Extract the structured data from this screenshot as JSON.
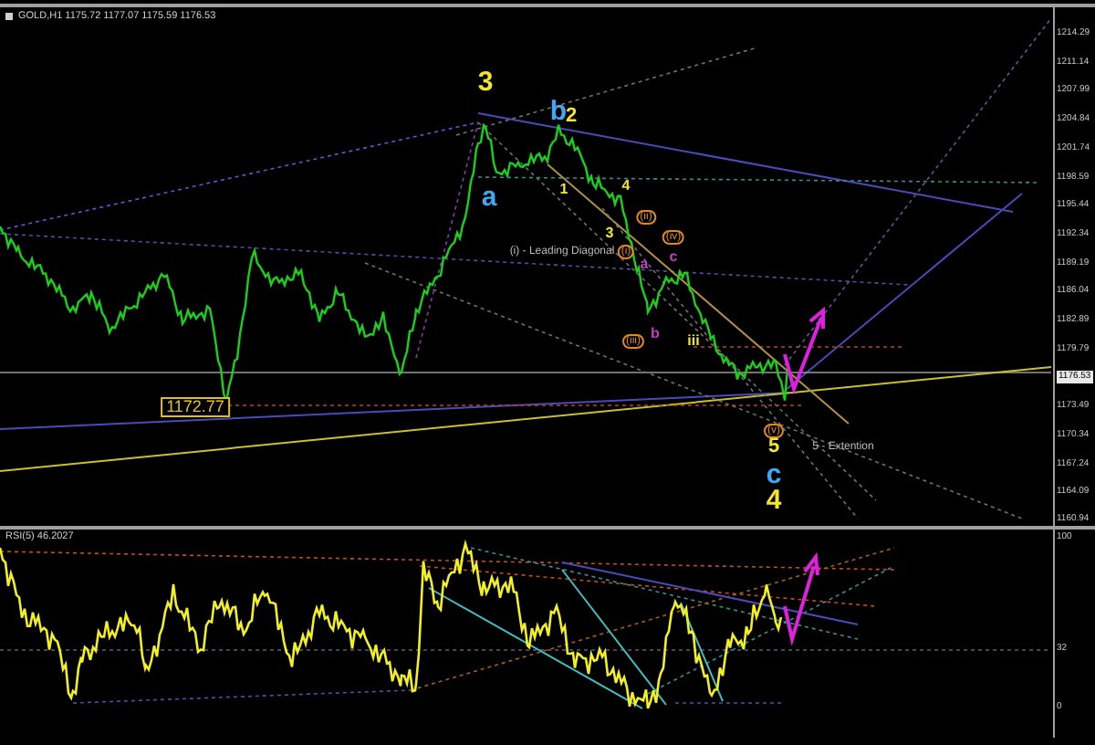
{
  "chart_window": {
    "title": "GOLD,H1 1175.72 1177.07 1175.59 1176.53"
  },
  "price_axis": {
    "labels": [
      {
        "text": "1214.29",
        "kind": "tick"
      },
      {
        "text": "1211.14",
        "kind": "tick"
      },
      {
        "text": "1207.99",
        "kind": "tick"
      },
      {
        "text": "1204.84",
        "kind": "tick"
      },
      {
        "text": "1201.74",
        "kind": "tick"
      },
      {
        "text": "1198.59",
        "kind": "tick"
      },
      {
        "text": "1195.44",
        "kind": "tick"
      },
      {
        "text": "1192.34",
        "kind": "tick"
      },
      {
        "text": "1189.19",
        "kind": "tick"
      },
      {
        "text": "1186.04",
        "kind": "tick"
      },
      {
        "text": "1182.89",
        "kind": "tick"
      },
      {
        "text": "1179.79",
        "kind": "tick"
      },
      {
        "text": "1176.53",
        "kind": "current"
      },
      {
        "text": "1173.49",
        "kind": "tick"
      },
      {
        "text": "1170.34",
        "kind": "tick"
      },
      {
        "text": "1167.24",
        "kind": "tick"
      },
      {
        "text": "1164.09",
        "kind": "tick"
      },
      {
        "text": "1160.94",
        "kind": "tick"
      }
    ]
  },
  "annotations": [
    {
      "text": "3",
      "kind": "big",
      "color": "#f2e629"
    },
    {
      "text": "b",
      "kind": "big",
      "color": "#3fa9f5"
    },
    {
      "text": "2",
      "kind": "mid",
      "color": "#f2e629"
    },
    {
      "text": "a",
      "kind": "big",
      "color": "#3fa9f5"
    },
    {
      "text": "1",
      "kind": "small",
      "color": "#f2e629"
    },
    {
      "text": "4",
      "kind": "small",
      "color": "#f2e629"
    },
    {
      "text": "3",
      "kind": "small",
      "color": "#f2e629"
    },
    {
      "text": "(ii)",
      "kind": "circled",
      "color": "#e08a1e"
    },
    {
      "text": "(iv)",
      "kind": "circled",
      "color": "#e08a1e"
    },
    {
      "text": "(i) - Leading Diagonal",
      "kind": "note",
      "color": "#bbbbbb"
    },
    {
      "text": "(i)",
      "kind": "circled",
      "color": "#e08a1e"
    },
    {
      "text": "c",
      "kind": "small",
      "color": "#c040c0"
    },
    {
      "text": "a",
      "kind": "small",
      "color": "#c040c0"
    },
    {
      "text": "(iii)",
      "kind": "circled",
      "color": "#e08a1e"
    },
    {
      "text": "b",
      "kind": "small",
      "color": "#c040c0"
    },
    {
      "text": "iii",
      "kind": "small",
      "color": "#f2e629"
    },
    {
      "text": "1172.77",
      "kind": "price",
      "color": "#e0c020"
    },
    {
      "text": "(v)",
      "kind": "circled",
      "color": "#e08a1e"
    },
    {
      "text": "5",
      "kind": "mid",
      "color": "#f2e629"
    },
    {
      "text": "5 - Extention",
      "kind": "note",
      "color": "#bbbbbb"
    },
    {
      "text": "c",
      "kind": "big",
      "color": "#3fa9f5"
    },
    {
      "text": "4",
      "kind": "big",
      "color": "#f2e629"
    }
  ],
  "rsi_window": {
    "title": "RSI(5) 46.2027",
    "axis_labels": [
      "100",
      "32",
      "0"
    ]
  }
}
